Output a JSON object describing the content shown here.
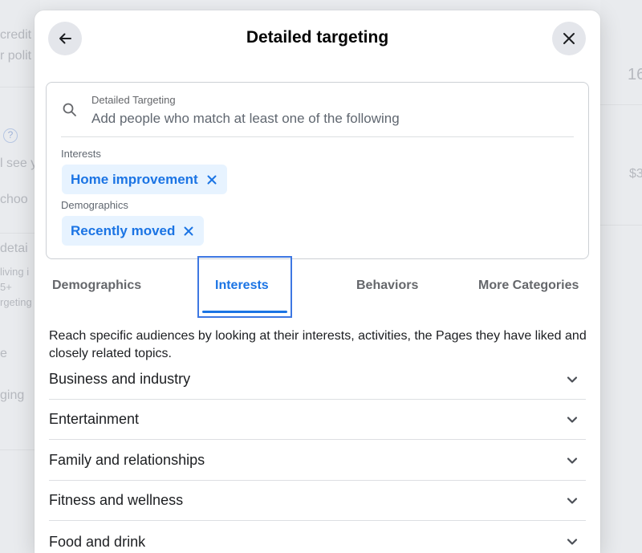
{
  "background": {
    "fragments": [
      "credit",
      "r polit",
      "l see y",
      "choo",
      "detai",
      "living i",
      "5+",
      "rgeting",
      "e",
      "ging",
      "16",
      "$3"
    ]
  },
  "modal": {
    "title": "Detailed targeting",
    "back_icon": "arrow-left-icon",
    "close_icon": "close-icon"
  },
  "search": {
    "label": "Detailed Targeting",
    "placeholder": "Add people who match at least one of the following",
    "value": ""
  },
  "selections": [
    {
      "section": "Interests",
      "chip": "Home improvement"
    },
    {
      "section": "Demographics",
      "chip": "Recently moved"
    }
  ],
  "tabs": [
    {
      "label": "Demographics",
      "active": false
    },
    {
      "label": "Interests",
      "active": true
    },
    {
      "label": "Behaviors",
      "active": false
    },
    {
      "label": "More Categories",
      "active": false
    }
  ],
  "description": "Reach specific audiences by looking at their interests, activities, the Pages they have liked and closely related topics.",
  "categories": [
    "Business and industry",
    "Entertainment",
    "Family and relationships",
    "Fitness and wellness",
    "Food and drink"
  ],
  "colors": {
    "accent": "#1b74e4",
    "chip_bg": "#e7f3ff",
    "focus_ring": "#3d77e2"
  }
}
